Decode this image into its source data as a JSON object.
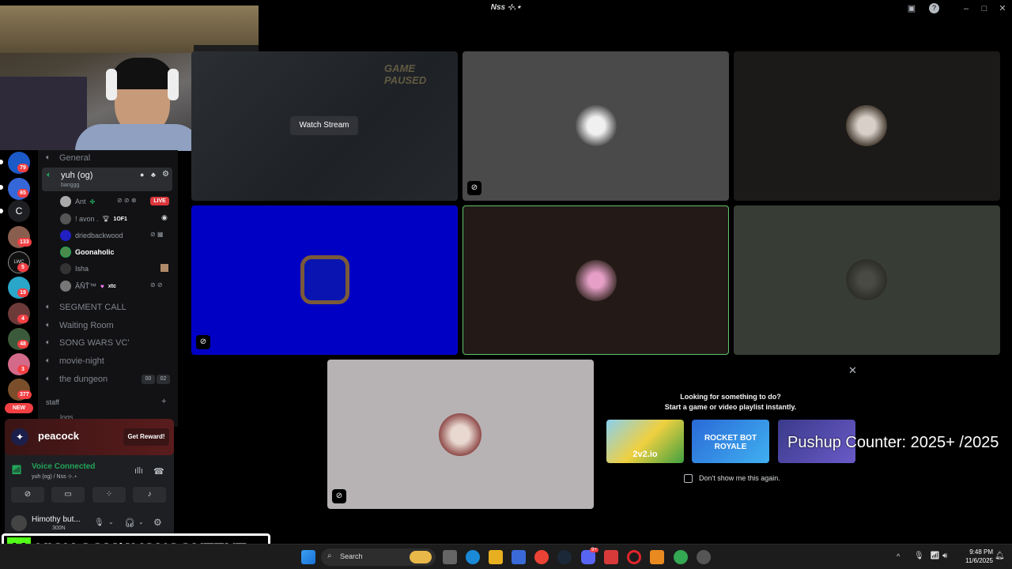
{
  "window": {
    "title": "Nss ⊹.⋆"
  },
  "guild_badges": [
    "79",
    "65",
    "133",
    "5",
    "19",
    "4",
    "48",
    "3",
    "377"
  ],
  "guild_letter": "C",
  "guild_lwc": "LWC",
  "new_badge": "NEW",
  "channels": {
    "general": "General",
    "active_name": "yuh (og)",
    "active_status": "banggg",
    "users": [
      {
        "name": "Ant",
        "tag": "LIVE"
      },
      {
        "name": "! avon .",
        "tag": "1OF1"
      },
      {
        "name": "driedbackwood",
        "tag": ""
      },
      {
        "name": "Goonaholic",
        "tag": ""
      },
      {
        "name": "Isha",
        "tag": ""
      },
      {
        "name": "ÂÑŤ™",
        "tag": "xtc"
      }
    ],
    "others": [
      "SEGMENT CALL",
      "Waiting Room",
      "SONG WARS VC'",
      "movie-night",
      "the dungeon"
    ],
    "dungeon_counts": [
      "00",
      "02"
    ],
    "category": "staff",
    "logs": "logs"
  },
  "promo": {
    "brand": "peacock",
    "cta": "Get Reward!"
  },
  "voice": {
    "status": "Voice Connected",
    "location": "yuh (og) / Nss ⊹.⋆"
  },
  "account": {
    "name": "Himothy but...",
    "sub": "300N"
  },
  "stream": {
    "watch_label": "Watch Stream",
    "overlay": "GAME PAUSED"
  },
  "activity": {
    "heading": "Looking for something to do?",
    "subheading": "Start a game or video playlist instantly.",
    "games": [
      "2v2.io",
      "ROCKET BOT ROYALE",
      ""
    ],
    "checkbox": "Don't show me this again."
  },
  "overlay_text": "Pushup Counter: 2025+ /2025",
  "kick_banner": "KICK.COM/AVONCONTENT",
  "taskbar": {
    "search": "Search",
    "time": "9:48 PM",
    "date": "11/6/2025",
    "discord_badge": "9+"
  }
}
